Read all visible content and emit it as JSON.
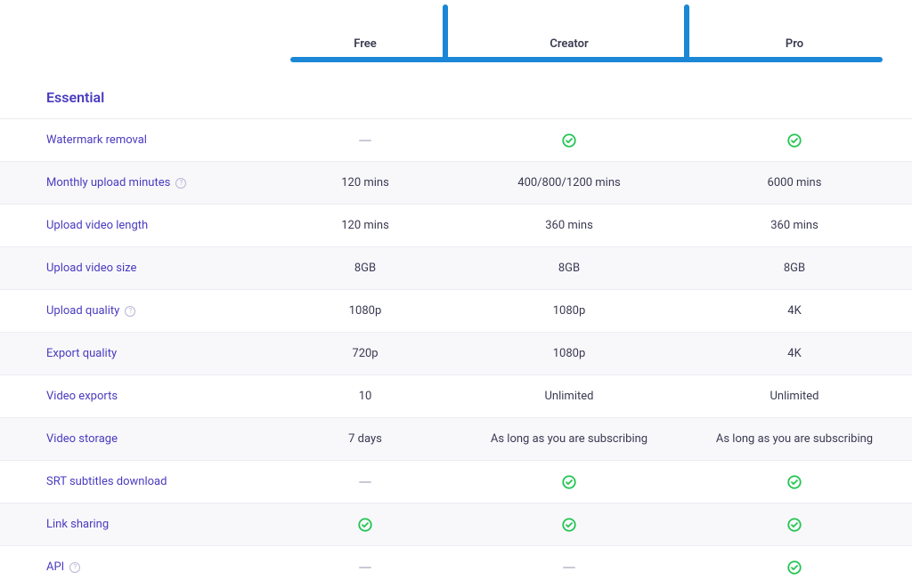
{
  "plans": {
    "free": "Free",
    "creator": "Creator",
    "pro": "Pro"
  },
  "section": "Essential",
  "rows": [
    {
      "label": "Watermark removal",
      "info": false,
      "free": "dash",
      "creator": "check",
      "pro": "check",
      "alt": false
    },
    {
      "label": "Monthly upload minutes",
      "info": true,
      "free": "120 mins",
      "creator": "400/800/1200 mins",
      "pro": "6000 mins",
      "alt": true
    },
    {
      "label": "Upload video length",
      "info": false,
      "free": "120 mins",
      "creator": "360 mins",
      "pro": "360 mins",
      "alt": false
    },
    {
      "label": "Upload video size",
      "info": false,
      "free": "8GB",
      "creator": "8GB",
      "pro": "8GB",
      "alt": true
    },
    {
      "label": "Upload quality",
      "info": true,
      "free": "1080p",
      "creator": "1080p",
      "pro": "4K",
      "alt": false
    },
    {
      "label": "Export quality",
      "info": false,
      "free": "720p",
      "creator": "1080p",
      "pro": "4K",
      "alt": true
    },
    {
      "label": "Video exports",
      "info": false,
      "free": "10",
      "creator": "Unlimited",
      "pro": "Unlimited",
      "alt": false
    },
    {
      "label": "Video storage",
      "info": false,
      "free": "7 days",
      "creator": "As long as you are subscribing",
      "pro": "As long as you are subscribing",
      "alt": true
    },
    {
      "label": "SRT subtitles download",
      "info": false,
      "free": "dash",
      "creator": "check",
      "pro": "check",
      "alt": false
    },
    {
      "label": "Link sharing",
      "info": false,
      "free": "check",
      "creator": "check",
      "pro": "check",
      "alt": true
    },
    {
      "label": "API",
      "info": true,
      "free": "dash",
      "creator": "dash",
      "pro": "check",
      "alt": false
    }
  ],
  "colors": {
    "accent": "#4a3bbf",
    "check": "#23c552",
    "annotation": "#1b87d6"
  }
}
